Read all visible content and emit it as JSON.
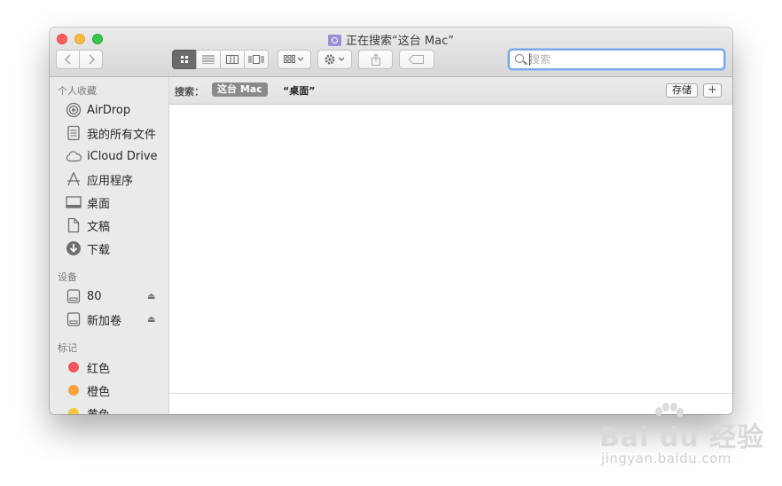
{
  "window": {
    "title": "正在搜索“这台 Mac”"
  },
  "toolbar": {
    "search_placeholder": "搜索",
    "icons": [
      "back-icon",
      "forward-icon",
      "icon-view-icon",
      "list-view-icon",
      "column-view-icon",
      "cover-flow-icon",
      "arrange-icon",
      "action-gear-icon",
      "share-icon",
      "tag-icon"
    ]
  },
  "sidebar": {
    "favorites_header": "个人收藏",
    "favorites": [
      {
        "label": "AirDrop",
        "icon": "airdrop-icon"
      },
      {
        "label": "我的所有文件",
        "icon": "all-files-icon"
      },
      {
        "label": "iCloud Drive",
        "icon": "cloud-icon"
      },
      {
        "label": "应用程序",
        "icon": "applications-icon"
      },
      {
        "label": "桌面",
        "icon": "desktop-icon"
      },
      {
        "label": "文稿",
        "icon": "documents-icon"
      },
      {
        "label": "下载",
        "icon": "downloads-icon"
      }
    ],
    "devices_header": "设备",
    "devices": [
      {
        "label": "80",
        "icon": "disk-icon"
      },
      {
        "label": "新加卷",
        "icon": "disk-icon"
      }
    ],
    "tags_header": "标记",
    "tags": [
      {
        "label": "红色",
        "color": "#f2565b"
      },
      {
        "label": "橙色",
        "color": "#f5a33a"
      },
      {
        "label": "黄色",
        "color": "#f4c843"
      }
    ]
  },
  "scopebar": {
    "label": "搜索：",
    "active_scope": "这台 Mac",
    "other_scope": "“桌面”",
    "save_label": "存储",
    "add_label": "+"
  },
  "watermark": {
    "brand": "Bai du 经验",
    "url": "jingyan.baidu.com"
  }
}
